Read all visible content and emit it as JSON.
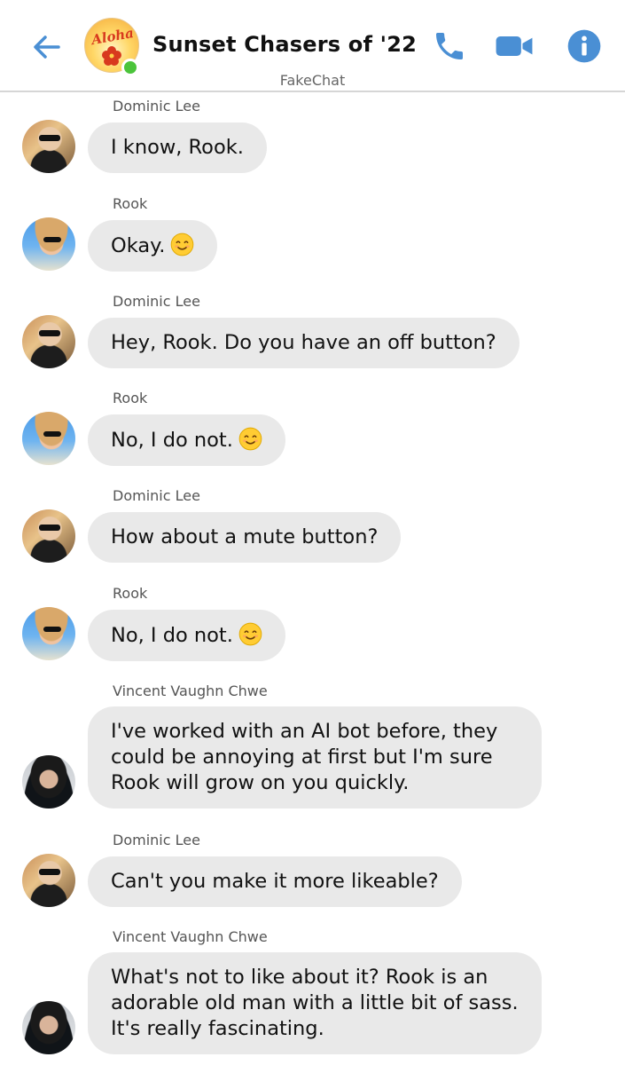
{
  "header": {
    "title": "Sunset Chasers of '22",
    "app_name": "FakeChat",
    "group_avatar_text": "Aloha"
  },
  "colors": {
    "accent": "#4a8fd4",
    "bubble": "#e9e9e9",
    "online": "#4bc43b"
  },
  "icons": {
    "back": "arrow-left-icon",
    "call": "phone-icon",
    "video": "video-camera-icon",
    "info": "info-icon",
    "emoji": "smiling-face-icon"
  },
  "messages": [
    {
      "sender": "Dominic Lee",
      "avatar": "dominic",
      "lines": [
        "I know, Rook."
      ],
      "emoji": false
    },
    {
      "sender": "Rook",
      "avatar": "rook",
      "lines": [
        "Okay."
      ],
      "emoji": true
    },
    {
      "sender": "Dominic Lee",
      "avatar": "dominic",
      "lines": [
        "Hey, Rook. Do you have an off button?"
      ],
      "emoji": false
    },
    {
      "sender": "Rook",
      "avatar": "rook",
      "lines": [
        "No, I do not."
      ],
      "emoji": true
    },
    {
      "sender": "Dominic Lee",
      "avatar": "dominic",
      "lines": [
        "How about a mute button?"
      ],
      "emoji": false
    },
    {
      "sender": "Rook",
      "avatar": "rook",
      "lines": [
        "No, I do not."
      ],
      "emoji": true
    },
    {
      "sender": "Vincent Vaughn Chwe",
      "avatar": "vincent",
      "lines": [
        "I've worked with an AI bot before, they",
        "could be annoying at first but I'm sure",
        "Rook will grow on you quickly."
      ],
      "emoji": false
    },
    {
      "sender": "Dominic Lee",
      "avatar": "dominic",
      "lines": [
        "Can't you make it more likeable?"
      ],
      "emoji": false
    },
    {
      "sender": "Vincent Vaughn Chwe",
      "avatar": "vincent",
      "lines": [
        "What's not to like about it? Rook is an",
        "adorable old man with a little bit of sass.",
        "It's really fascinating."
      ],
      "emoji": false
    }
  ]
}
